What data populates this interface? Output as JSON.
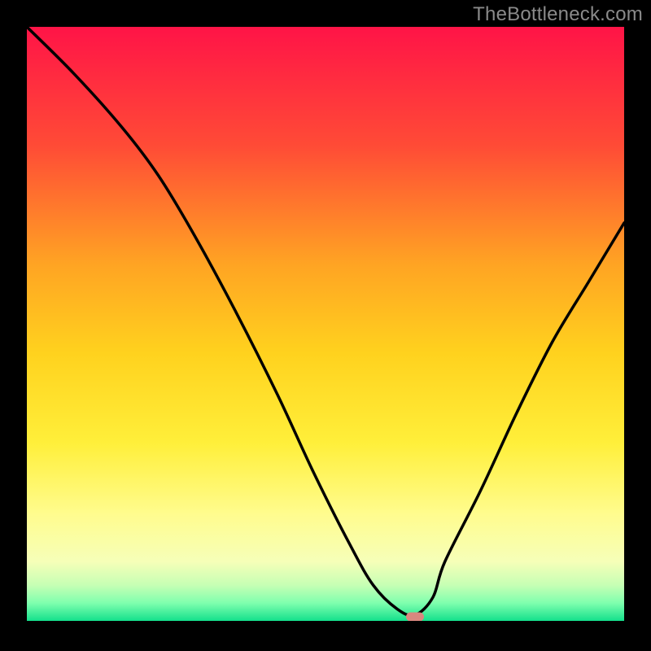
{
  "watermark": "TheBottleneck.com",
  "chart_data": {
    "type": "line",
    "title": "",
    "xlabel": "",
    "ylabel": "",
    "xlim": [
      0,
      100
    ],
    "ylim": [
      0,
      100
    ],
    "x": [
      0,
      8,
      16,
      22,
      28,
      35,
      42,
      48,
      54,
      58,
      62,
      65,
      68,
      70,
      76,
      82,
      88,
      94,
      100
    ],
    "values": [
      100,
      92,
      83,
      75,
      65,
      52,
      38,
      25,
      13,
      6,
      2,
      1,
      4,
      10,
      22,
      35,
      47,
      57,
      67
    ],
    "optimal_x": 65,
    "gradient_stops": [
      {
        "pct": 0,
        "color": "#ff1447"
      },
      {
        "pct": 20,
        "color": "#ff4b36"
      },
      {
        "pct": 40,
        "color": "#ffa423"
      },
      {
        "pct": 55,
        "color": "#ffd21e"
      },
      {
        "pct": 70,
        "color": "#ffef3a"
      },
      {
        "pct": 82,
        "color": "#fffc8e"
      },
      {
        "pct": 90,
        "color": "#f6ffb8"
      },
      {
        "pct": 94,
        "color": "#c6ffb4"
      },
      {
        "pct": 97,
        "color": "#7fffae"
      },
      {
        "pct": 100,
        "color": "#14e08c"
      }
    ]
  }
}
